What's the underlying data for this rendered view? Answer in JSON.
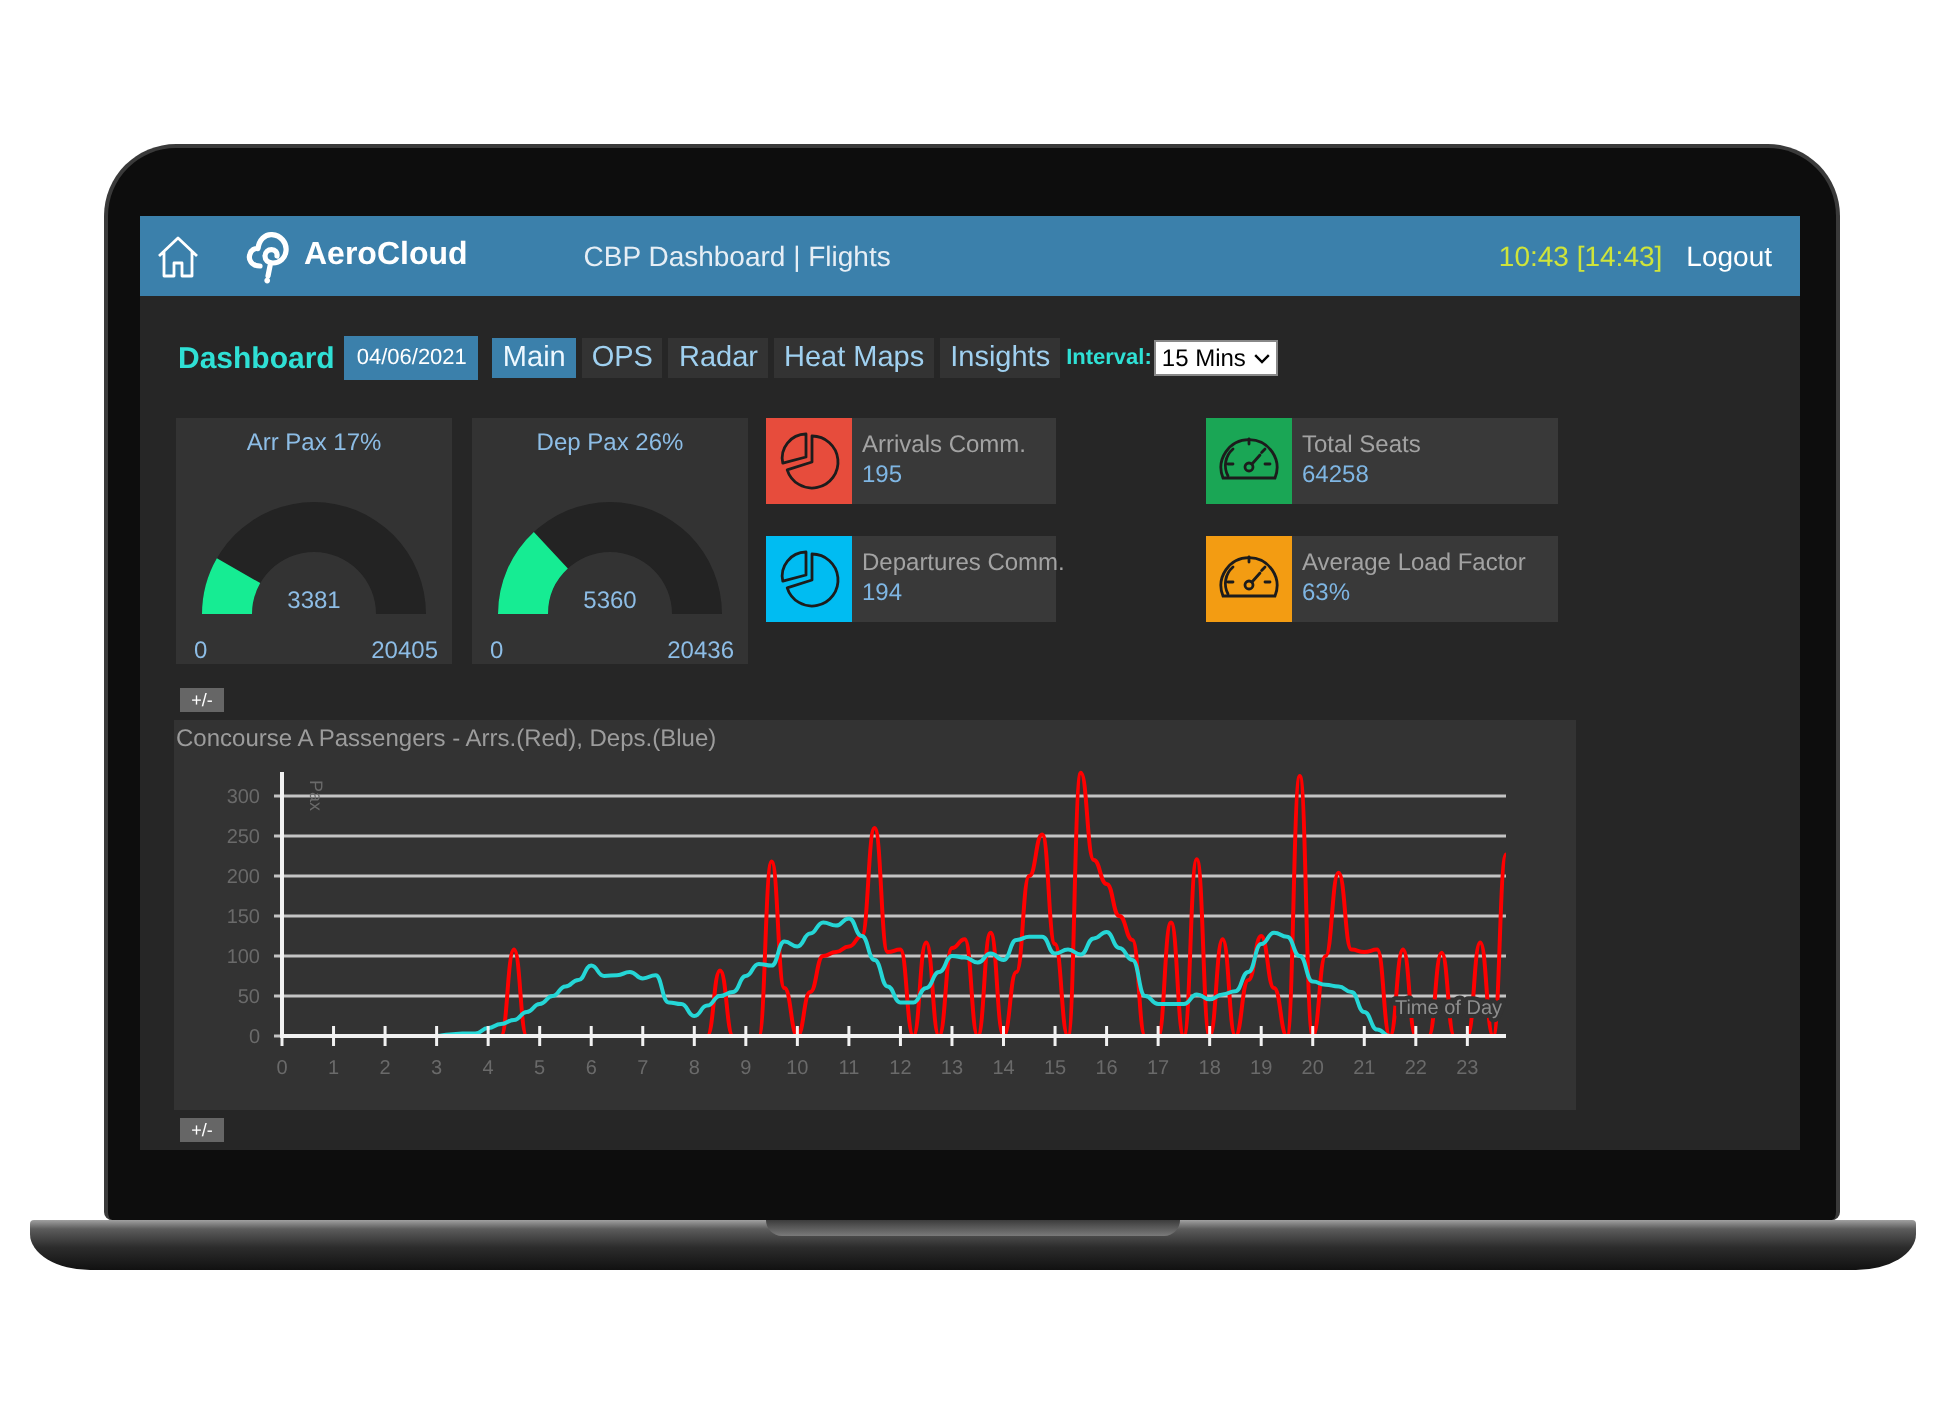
{
  "header": {
    "brand": "AeroCloud",
    "title": "CBP Dashboard | Flights",
    "clock": "10:43 [14:43]",
    "logout": "Logout"
  },
  "toolbar": {
    "heading": "Dashboard",
    "date": "04/06/2021",
    "tabs": [
      {
        "label": "Main",
        "selected": true
      },
      {
        "label": "OPS",
        "selected": false
      },
      {
        "label": "Radar",
        "selected": false
      },
      {
        "label": "Heat Maps",
        "selected": false
      },
      {
        "label": "Insights",
        "selected": false
      }
    ],
    "interval": {
      "label": "Interval:",
      "value": "15 Mins"
    }
  },
  "gauges": [
    {
      "title": "Arr Pax 17%",
      "value": "3381",
      "min": "0",
      "max": "20405",
      "level": 0.166
    },
    {
      "title": "Dep Pax 26%",
      "value": "5360",
      "min": "0",
      "max": "20436",
      "level": 0.262
    }
  ],
  "comm_tiles": [
    {
      "label": "Arrivals Comm.",
      "value": "195",
      "color": "#e74c3c"
    },
    {
      "label": "Departures Comm.",
      "value": "194",
      "color": "#00bcf2"
    }
  ],
  "capacity_tiles": [
    {
      "label": "Total Seats",
      "value": "64258",
      "color": "#1aa655"
    },
    {
      "label": "Average Load Factor",
      "value": "63%",
      "color": "#f39c12"
    }
  ],
  "chart_panel": {
    "toggle": "+/-",
    "chart_data": {
      "type": "line",
      "title": "Concourse A Passengers - Arrs.(Red), Deps.(Blue)",
      "xlabel": "Time of Day",
      "ylabel": "Pax",
      "x": [
        2.75,
        3,
        3.25,
        3.5,
        3.75,
        4,
        4.25,
        4.5,
        4.75,
        5,
        5.25,
        5.5,
        5.75,
        6,
        6.25,
        6.5,
        6.75,
        7,
        7.25,
        7.5,
        7.75,
        8,
        8.25,
        8.5,
        8.75,
        9,
        9.25,
        9.5,
        9.75,
        10,
        10.25,
        10.5,
        10.75,
        11,
        11.25,
        11.5,
        11.75,
        12,
        12.25,
        12.5,
        12.75,
        13,
        13.25,
        13.5,
        13.75,
        14,
        14.25,
        14.5,
        14.75,
        15,
        15.25,
        15.5,
        15.75,
        16,
        16.25,
        16.5,
        16.75,
        17,
        17.25,
        17.5,
        17.75,
        18,
        18.25,
        18.5,
        18.75,
        19,
        19.25,
        19.5,
        19.75,
        20,
        20.25,
        20.5,
        20.75,
        21,
        21.25,
        21.5,
        21.75,
        22,
        22.25,
        22.5,
        22.75,
        23,
        23.25,
        23.5,
        23.75
      ],
      "series": [
        {
          "color": "#ff0000",
          "values": [
            null,
            null,
            null,
            null,
            null,
            0,
            0,
            108,
            0,
            0,
            0,
            0,
            0,
            0,
            0,
            0,
            0,
            0,
            0,
            0,
            0,
            0,
            0,
            82,
            0,
            0,
            0,
            218,
            60,
            0,
            55,
            100,
            105,
            112,
            125,
            260,
            105,
            108,
            0,
            117,
            0,
            110,
            121,
            0,
            129,
            0,
            80,
            200,
            252,
            115,
            0,
            329,
            220,
            190,
            150,
            120,
            0,
            0,
            142,
            0,
            221,
            0,
            121,
            0,
            70,
            125,
            60,
            0,
            325,
            0,
            100,
            204,
            108,
            105,
            108,
            0,
            108,
            0,
            0,
            104,
            0,
            0,
            117,
            0,
            227
          ]
        },
        {
          "color": "#25d6d6",
          "values": [
            0,
            0,
            2,
            3,
            3,
            10,
            15,
            20,
            30,
            40,
            50,
            62,
            70,
            88,
            75,
            76,
            80,
            72,
            76,
            42,
            40,
            25,
            38,
            50,
            55,
            75,
            90,
            88,
            118,
            112,
            128,
            142,
            138,
            147,
            125,
            95,
            62,
            42,
            42,
            60,
            80,
            100,
            98,
            92,
            103,
            95,
            120,
            124,
            124,
            103,
            108,
            102,
            122,
            130,
            110,
            95,
            50,
            40,
            40,
            40,
            52,
            46,
            52,
            56,
            80,
            115,
            129,
            124,
            100,
            68,
            64,
            62,
            55,
            30,
            8,
            0,
            0,
            null,
            null,
            null,
            null,
            null,
            null,
            null,
            null
          ]
        }
      ],
      "xlim": [
        0,
        23.75
      ],
      "ylim": [
        0,
        330
      ],
      "xticks": [
        0,
        1,
        2,
        3,
        4,
        5,
        6,
        7,
        8,
        9,
        10,
        11,
        12,
        13,
        14,
        15,
        16,
        17,
        18,
        19,
        20,
        21,
        22,
        23
      ],
      "yticks": [
        0,
        50,
        100,
        150,
        200,
        250,
        300
      ],
      "grid": true
    }
  },
  "footer_toggle": "+/-"
}
